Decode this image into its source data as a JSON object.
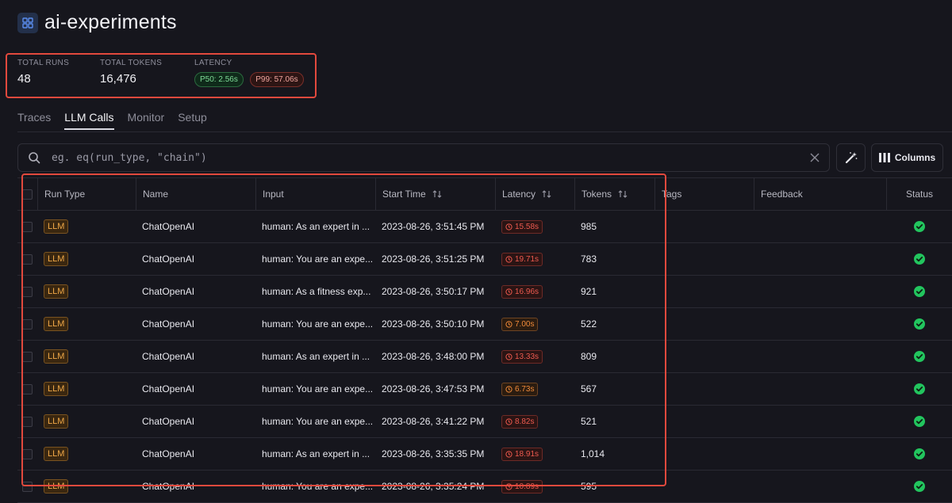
{
  "project": {
    "title": "ai-experiments",
    "icon": "grid-icon"
  },
  "stats": {
    "total_runs_label": "TOTAL RUNS",
    "total_runs": "48",
    "total_tokens_label": "TOTAL TOKENS",
    "total_tokens": "16,476",
    "latency_label": "LATENCY",
    "p50": "P50: 2.56s",
    "p99": "P99: 57.06s"
  },
  "tabs": [
    {
      "label": "Traces",
      "active": false
    },
    {
      "label": "LLM Calls",
      "active": true
    },
    {
      "label": "Monitor",
      "active": false
    },
    {
      "label": "Setup",
      "active": false
    }
  ],
  "search": {
    "placeholder": "eg. eq(run_type, \"chain\")",
    "value": ""
  },
  "toolbar": {
    "columns_label": "Columns"
  },
  "table": {
    "columns": [
      "Run Type",
      "Name",
      "Input",
      "Start Time",
      "Latency",
      "Tokens",
      "Tags",
      "Feedback",
      "Status"
    ],
    "rows": [
      {
        "run_type": "LLM",
        "name": "ChatOpenAI",
        "input": "human: As an expert in ...",
        "start_time": "2023-08-26, 3:51:45 PM",
        "latency": "15.58s",
        "latency_level": "red",
        "tokens": "985"
      },
      {
        "run_type": "LLM",
        "name": "ChatOpenAI",
        "input": "human: You are an expe...",
        "start_time": "2023-08-26, 3:51:25 PM",
        "latency": "19.71s",
        "latency_level": "red",
        "tokens": "783"
      },
      {
        "run_type": "LLM",
        "name": "ChatOpenAI",
        "input": "human: As a fitness exp...",
        "start_time": "2023-08-26, 3:50:17 PM",
        "latency": "16.96s",
        "latency_level": "red",
        "tokens": "921"
      },
      {
        "run_type": "LLM",
        "name": "ChatOpenAI",
        "input": "human: You are an expe...",
        "start_time": "2023-08-26, 3:50:10 PM",
        "latency": "7.00s",
        "latency_level": "orange",
        "tokens": "522"
      },
      {
        "run_type": "LLM",
        "name": "ChatOpenAI",
        "input": "human: As an expert in ...",
        "start_time": "2023-08-26, 3:48:00 PM",
        "latency": "13.33s",
        "latency_level": "red",
        "tokens": "809"
      },
      {
        "run_type": "LLM",
        "name": "ChatOpenAI",
        "input": "human: You are an expe...",
        "start_time": "2023-08-26, 3:47:53 PM",
        "latency": "6.73s",
        "latency_level": "orange",
        "tokens": "567"
      },
      {
        "run_type": "LLM",
        "name": "ChatOpenAI",
        "input": "human: You are an expe...",
        "start_time": "2023-08-26, 3:41:22 PM",
        "latency": "8.82s",
        "latency_level": "red",
        "tokens": "521"
      },
      {
        "run_type": "LLM",
        "name": "ChatOpenAI",
        "input": "human: As an expert in ...",
        "start_time": "2023-08-26, 3:35:35 PM",
        "latency": "18.91s",
        "latency_level": "red",
        "tokens": "1,014"
      },
      {
        "run_type": "LLM",
        "name": "ChatOpenAI",
        "input": "human: You are an expe...",
        "start_time": "2023-08-26, 3:35:24 PM",
        "latency": "10.89s",
        "latency_level": "red",
        "tokens": "595"
      }
    ]
  },
  "colors": {
    "accent_highlight": "#e2493d",
    "status_success": "#22c55e",
    "llm_badge": "#f0a847",
    "latency_red": "#ee5a4f",
    "latency_orange": "#f08a3a"
  }
}
